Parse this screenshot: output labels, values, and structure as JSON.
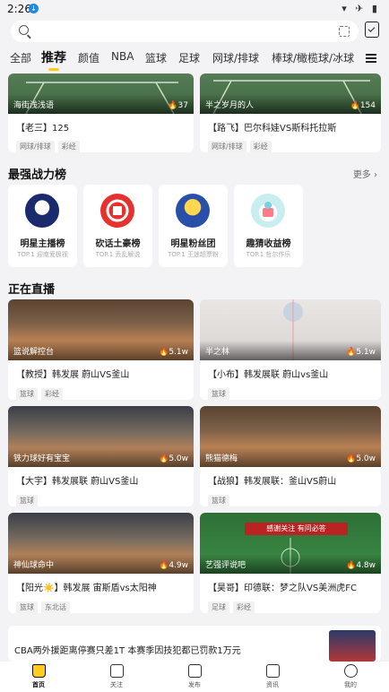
{
  "status": {
    "time": "2:26",
    "right_icons": "▾ ✈ ▮"
  },
  "search": {
    "placeholder": ""
  },
  "tabs": [
    "全部",
    "推荐",
    "颜值",
    "NBA",
    "篮球",
    "足球",
    "网球/排球",
    "棒球/橄榄球/冰球"
  ],
  "active_tab": "推荐",
  "top_cards": [
    {
      "author": "海街浅浅语",
      "heat": "37",
      "title": "【老三】125",
      "tags": [
        "网球/排球",
        "彩经"
      ]
    },
    {
      "author": "半之岁月的人",
      "heat": "154",
      "title": "【路飞】巴尔科娃VS斯科托拉斯",
      "tags": [
        "网球/排球",
        "彩经"
      ]
    }
  ],
  "ranking": {
    "title": "最强战力榜",
    "more": "更多",
    "items": [
      {
        "name": "明星主播榜",
        "sub": "TOP.1 迎南爱极视"
      },
      {
        "name": "砍话土豪榜",
        "sub": "TOP.1 丢乱解说"
      },
      {
        "name": "明星粉丝团",
        "sub": "TOP.1 王迷超票粉"
      },
      {
        "name": "趣猜收益榜",
        "sub": "TOP.1 哲尔作乐"
      }
    ]
  },
  "live": {
    "title": "正在直播",
    "cards": [
      {
        "author": "篮说解控台",
        "heat": "5.1w",
        "title": "【教授】韩发展 蔚山VS釜山",
        "tags": [
          "篮球",
          "彩经"
        ]
      },
      {
        "author": "半之林",
        "heat": "5.1w",
        "title": "【小布】韩发展联 蔚山vs釜山",
        "tags": [
          "篮球"
        ]
      },
      {
        "author": "铁力球好有宝宝",
        "heat": "5.0w",
        "title": "【大宇】韩发展联 蔚山VS釜山",
        "tags": [
          "篮球"
        ]
      },
      {
        "author": "熊猫德梅",
        "heat": "5.0w",
        "title": "【战狼】韩发展联：釜山VS蔚山",
        "tags": [
          "篮球"
        ]
      },
      {
        "author": "神仙球命中",
        "heat": "4.9w",
        "title": "【阳光☀️】韩发展 宙斯盾vs太阳神",
        "tags": [
          "篮球",
          "东北话"
        ]
      },
      {
        "author": "艺强评说吧",
        "heat": "4.8w",
        "title": "【昊哥】印德联：梦之队VS美洲虎FC",
        "tags": [
          "足球",
          "彩经"
        ],
        "banner": "感谢关注 有问必答"
      }
    ]
  },
  "news": {
    "headline": "CBA两外援距离停赛只差1T 本赛季因技犯都已罚款1万元"
  },
  "nav": [
    "首页",
    "关注",
    "发布",
    "资讯",
    "我的"
  ],
  "colors": {
    "accent": "#ffcc1e"
  }
}
